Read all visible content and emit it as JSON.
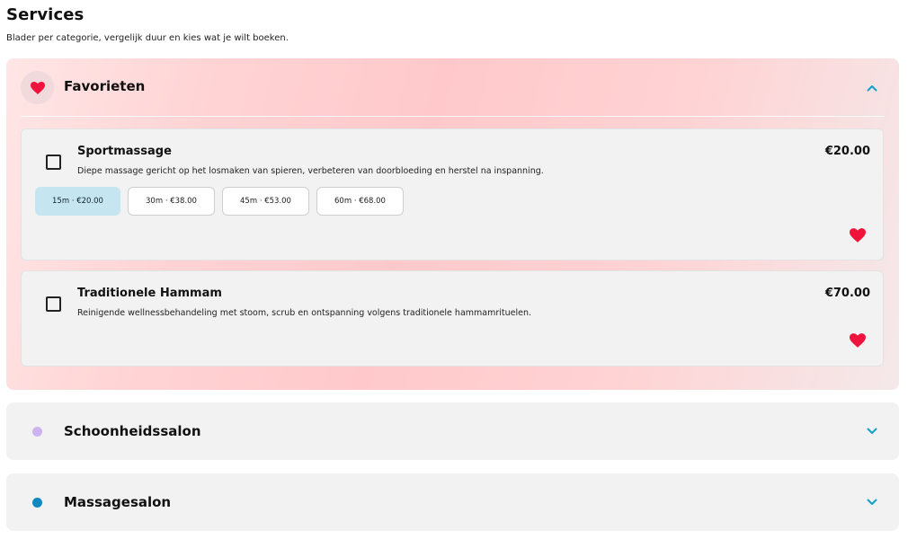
{
  "page": {
    "title": "Services",
    "subtitle": "Blader per categorie, vergelijk duur en kies wat je wilt boeken."
  },
  "favorites": {
    "title": "Favorieten",
    "icon": "heart-icon",
    "expanded": true,
    "services": [
      {
        "name": "Sportmassage",
        "price": "€20.00",
        "description": "Diepe massage gericht op het losmaken van spieren, verbeteren van doorbloeding en herstel na inspanning.",
        "checked": false,
        "favorite": true,
        "durations": [
          {
            "label": "15m · €20.00",
            "selected": true
          },
          {
            "label": "30m · €38.00",
            "selected": false
          },
          {
            "label": "45m · €53.00",
            "selected": false
          },
          {
            "label": "60m · €68.00",
            "selected": false
          }
        ]
      },
      {
        "name": "Traditionele Hammam",
        "price": "€70.00",
        "description": "Reinigende wellnessbehandeling met stoom, scrub en ontspanning volgens traditionele hammamrituelen.",
        "checked": false,
        "favorite": true,
        "durations": []
      }
    ]
  },
  "categories": [
    {
      "title": "Schoonheidssalon",
      "dot_color": "#cdb4f0",
      "expanded": false
    },
    {
      "title": "Massagesalon",
      "dot_color": "#1088c0",
      "expanded": false
    }
  ],
  "colors": {
    "accent": "#12a0c8",
    "heart": "#f0143c",
    "duration_selected_bg": "#c5e6f0",
    "card_bg": "#f2f2f2"
  }
}
